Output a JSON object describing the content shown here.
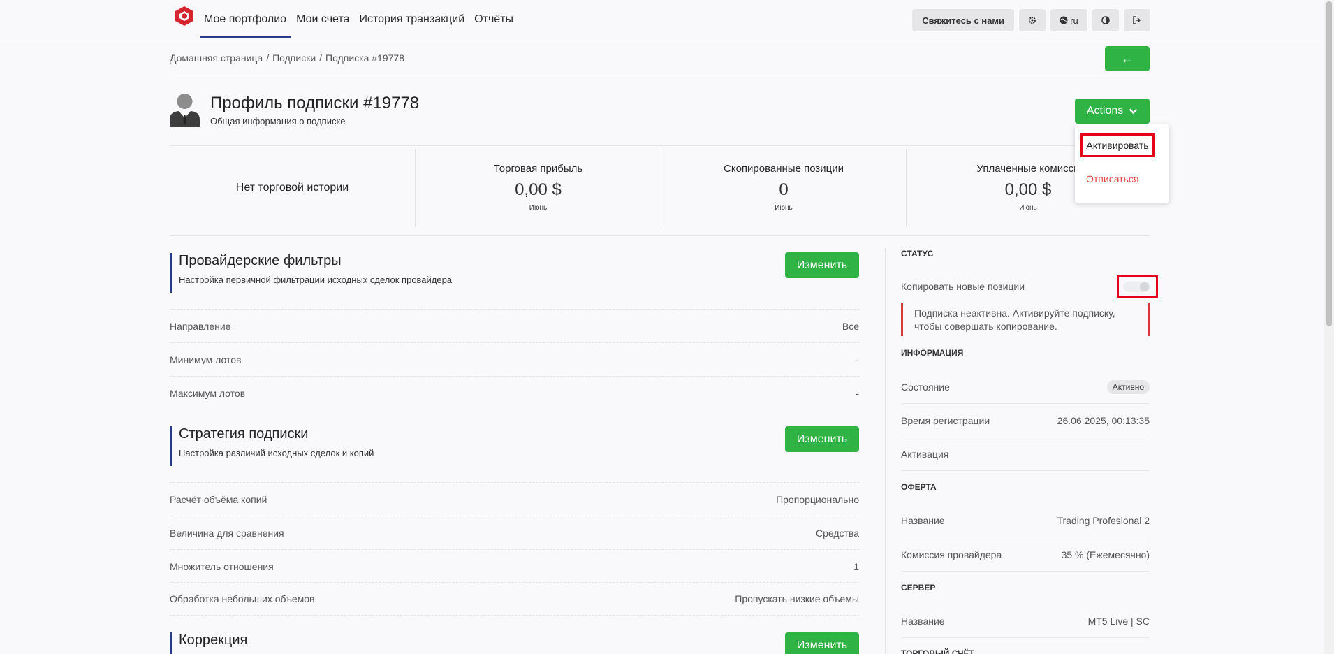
{
  "nav": {
    "items": [
      "Мое портфолио",
      "Мои счета",
      "История транзакций",
      "Отчёты"
    ],
    "contact_label": "Свяжитесь с нами",
    "lang": "ru"
  },
  "breadcrumb": [
    "Домашняя страница",
    "Подписки",
    "Подписка #19778"
  ],
  "back_label": "←",
  "header": {
    "title": "Профиль подписки #19778",
    "subtitle": "Общая информация о подписке",
    "actions_label": "Actions"
  },
  "dropdown": {
    "activate": "Активировать",
    "unsubscribe": "Отписаться"
  },
  "stats": {
    "no_history": "Нет торговой истории",
    "items": [
      {
        "label": "Торговая прибыль",
        "value": "0,00 $",
        "period": "Июнь"
      },
      {
        "label": "Скопированные позиции",
        "value": "0",
        "period": "Июнь"
      },
      {
        "label": "Уплаченные комисси",
        "value": "0,00 $",
        "period": "Июнь"
      }
    ]
  },
  "sections": [
    {
      "title": "Провайдерские фильтры",
      "desc": "Настройка первичной фильтрации исходных сделок провайдера",
      "edit": "Изменить",
      "rows": [
        {
          "label": "Направление",
          "value": "Все"
        },
        {
          "label": "Минимум лотов",
          "value": "-"
        },
        {
          "label": "Максимум лотов",
          "value": "-"
        }
      ]
    },
    {
      "title": "Стратегия подписки",
      "desc": "Настройка различий исходных сделок и копий",
      "edit": "Изменить",
      "rows": [
        {
          "label": "Расчёт объёма копий",
          "value": "Пропорционально"
        },
        {
          "label": "Величина для сравнения",
          "value": "Средства"
        },
        {
          "label": "Множитель отношения",
          "value": "1"
        },
        {
          "label": "Обработка небольших объемов",
          "value": "Пропускать низкие объемы"
        }
      ]
    },
    {
      "title": "Коррекция",
      "edit": "Изменить"
    }
  ],
  "right": {
    "status_head": "СТАТУС",
    "copy_new": "Копировать новые позиции",
    "alert": "Подписка неактивна. Активируйте подписку, чтобы совершать копирование.",
    "info_head": "ИНФОРМАЦИЯ",
    "state_label": "Состояние",
    "state_value": "Активно",
    "reg_label": "Время регистрации",
    "reg_value": "26.06.2025, 00:13:35",
    "activation_label": "Активация",
    "offer_head": "ОФЕРТА",
    "offer_name_label": "Название",
    "offer_name_value": "Trading Profesional 2",
    "commission_label": "Комиссия провайдера",
    "commission_value": "35 % (Ежемесячно)",
    "server_head": "СЕРВЕР",
    "server_name_label": "Название",
    "server_name_value": "MT5 Live | SC",
    "account_head": "ТОРГОВЫЙ СЧЁТ"
  }
}
